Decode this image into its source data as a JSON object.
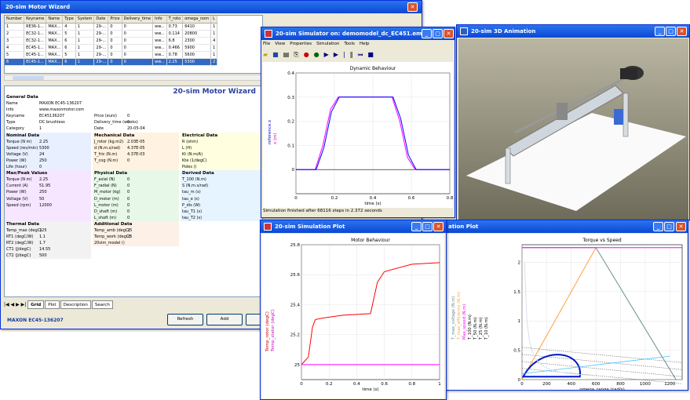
{
  "wizard": {
    "title": "20-sim Motor Wizard",
    "header": "20-sim Motor Wizard",
    "footer": "MAXON EC45-136207",
    "buttons": [
      "Refresh",
      "Add",
      "Cop"
    ],
    "columns": [
      "Number",
      "Keyname",
      "Name",
      "Type",
      "System",
      "Date",
      "Price",
      "Delivery_time",
      "Info",
      "T_roto",
      "omega_nom",
      "L"
    ],
    "rows": [
      [
        "1",
        "RE36-1...",
        "MAX...",
        "4",
        "1",
        "29-...",
        "0",
        "0",
        "ww...",
        "0.73",
        "6410",
        "1"
      ],
      [
        "2",
        "EC32-1...",
        "MAX...",
        "5",
        "1",
        "29-...",
        "0",
        "0",
        "ww...",
        "0.114",
        "20800",
        "1"
      ],
      [
        "3",
        "EC32-1...",
        "MAX...",
        "6",
        "1",
        "29-...",
        "0",
        "0",
        "ww...",
        "6.8",
        "2300",
        "4"
      ],
      [
        "4",
        "EC45-1...",
        "MAX...",
        "6",
        "1",
        "29-...",
        "0",
        "0",
        "ww...",
        "0.466",
        "5900",
        "1"
      ],
      [
        "5",
        "EC45-1...",
        "MAX...",
        "5",
        "1",
        "29-...",
        "0",
        "0",
        "ww...",
        "0.78",
        "5600",
        "1"
      ],
      [
        "6",
        "EC45-1...",
        "MAX...",
        "6",
        "1",
        "29-...",
        "0",
        "0",
        "ww...",
        "2.25",
        "5300",
        "2"
      ]
    ],
    "col1": [
      {
        "t": "General Data",
        "h": true
      },
      {
        "k": "Name",
        "v": "MAXON EC45-136207"
      },
      {
        "k": "Info",
        "v": "www.maxonmotor.com"
      },
      {
        "k": "Keyname",
        "v": "EC45136207"
      },
      {
        "k": "Type",
        "v": "DC brushless"
      },
      {
        "k": "Category",
        "v": "1"
      },
      {
        "t": "Nominal Data",
        "h": true
      },
      {
        "k": "Torque (N m)",
        "v": "2.25"
      },
      {
        "k": "Speed (rev/min)",
        "v": "5300"
      },
      {
        "k": "Voltage (V)",
        "v": "24"
      },
      {
        "k": "Power (W)",
        "v": "250"
      },
      {
        "k": "Life (hour)",
        "v": "0"
      },
      {
        "t": "Max/Peak Values",
        "h": true
      },
      {
        "k": "Torque (N m)",
        "v": "2.25"
      },
      {
        "k": "Current (A)",
        "v": "51.95"
      },
      {
        "k": "Power (W)",
        "v": "250"
      },
      {
        "k": "Voltage (V)",
        "v": "50"
      },
      {
        "k": "Speed (rpm)",
        "v": "12000"
      },
      {
        "k": "",
        "v": ""
      },
      {
        "k": "",
        "v": ""
      },
      {
        "t": "Thermal Data",
        "h": true
      },
      {
        "k": "Temp_max (degC)",
        "v": "125"
      },
      {
        "k": "RT1 (degC/W)",
        "v": "1.1"
      },
      {
        "k": "RT2 (degC/W)",
        "v": "1.7"
      },
      {
        "k": "CT1 (J/degC)",
        "v": "14.55"
      },
      {
        "k": "CT2 (J/degC)",
        "v": "500"
      }
    ],
    "col2": [
      {
        "k": "",
        "v": ""
      },
      {
        "k": "",
        "v": ""
      },
      {
        "k": "",
        "v": ""
      },
      {
        "k": "Price (euro)",
        "v": "0"
      },
      {
        "k": "Delivery_time (weeks)",
        "v": "0"
      },
      {
        "k": "Date",
        "v": "20-05-04"
      },
      {
        "t": "Mechanical Data",
        "h": true
      },
      {
        "k": "J_rotor (kg.m2)",
        "v": "2.03E-05"
      },
      {
        "k": "d (N.m.s/rad)",
        "v": "4.37E-05"
      },
      {
        "k": "T_fric (N.m)",
        "v": "4.37E-03"
      },
      {
        "k": "T_cog (N.m)",
        "v": "0"
      },
      {
        "k": "",
        "v": ""
      },
      {
        "t": "Physical Data",
        "h": true
      },
      {
        "k": "F_axial (N)",
        "v": "0"
      },
      {
        "k": "F_radial (N)",
        "v": "0"
      },
      {
        "k": "M_motor (kg)",
        "v": "0"
      },
      {
        "k": "D_motor (m)",
        "v": "0"
      },
      {
        "k": "L_motor (m)",
        "v": "0"
      },
      {
        "k": "D_shaft (m)",
        "v": "0"
      },
      {
        "k": "L_shaft (m)",
        "v": "0"
      },
      {
        "t": "Additional Data",
        "h": true
      },
      {
        "k": "Temp_amb (degC)",
        "v": "25"
      },
      {
        "k": "Temp_work (degC)",
        "v": "25"
      },
      {
        "k": "20sim_model ()",
        "v": ""
      }
    ],
    "col3": [
      {
        "k": "",
        "v": ""
      },
      {
        "k": "",
        "v": ""
      },
      {
        "k": "",
        "v": ""
      },
      {
        "k": "",
        "v": ""
      },
      {
        "k": "",
        "v": ""
      },
      {
        "k": "",
        "v": ""
      },
      {
        "t": "Electrical Data",
        "h": true
      },
      {
        "k": "R (ohm)",
        "v": ""
      },
      {
        "k": "L (H)",
        "v": ""
      },
      {
        "k": "Kt (N.m/A)",
        "v": ""
      },
      {
        "k": "Kte (1/degC)",
        "v": ""
      },
      {
        "k": "Poles ()",
        "v": ""
      },
      {
        "t": "Derived Data",
        "h": true
      },
      {
        "k": "T_100 (N.m)",
        "v": ""
      },
      {
        "k": "S (N.m.s/rad)",
        "v": ""
      },
      {
        "k": "tau_m (s)",
        "v": ""
      },
      {
        "k": "tau_e (s)",
        "v": ""
      },
      {
        "k": "P_dis (W)",
        "v": ""
      },
      {
        "k": "tau_T1 (s)",
        "v": ""
      },
      {
        "k": "tau_T2 (s)",
        "v": ""
      }
    ],
    "tabs": [
      "Grid",
      "Plot",
      "Description",
      "Search"
    ]
  },
  "sim": {
    "title": "20-sim Simulator on: demomodel_dc_EC451.emx",
    "menu": [
      "File",
      "View",
      "Properties",
      "Simulation",
      "Tools",
      "Help"
    ],
    "plot_title": "Dynamic Behaviour",
    "status": "Simulation finished after 68116 steps in 2.372 seconds",
    "ylabel_a": "reference.x",
    "ylabel_b": "x (m)",
    "xlabel": "time (s)"
  },
  "anim": {
    "title": "20-sim 3D Animation"
  },
  "plot2": {
    "title": "20-sim Simulation Plot",
    "plot_title": "Motor Behaviour",
    "xlabel": "time (s)",
    "ylabel_a": "Temp_rotor (degC)",
    "ylabel_b": "Temp_stator (degC)"
  },
  "plot3": {
    "title": "ation Plot",
    "plot_title": "Torque vs Speed",
    "xlabel": "omega_range (rad/s)",
    "legend": [
      "T_max_voltage (N.m)",
      "T_max_efficiency (N.m)",
      "Max_speed (N.m)",
      "T_100 (N.m)",
      "T_50 (N.m)",
      "T_25 (N.m)",
      "T_10 (N.m)"
    ]
  },
  "chart_data": [
    {
      "type": "line",
      "title": "Dynamic Behaviour",
      "xlabel": "time (s)",
      "ylabel": "reference.x / x (m)",
      "xlim": [
        0,
        0.8
      ],
      "ylim": [
        -0.1,
        0.4
      ],
      "xticks": [
        0,
        0.2,
        0.4,
        0.6,
        0.8
      ],
      "yticks": [
        0,
        0.1,
        0.2,
        0.3,
        0.4
      ],
      "series": [
        {
          "name": "reference.x",
          "color": "#ff00ff",
          "x": [
            0,
            0.1,
            0.14,
            0.18,
            0.22,
            0.5,
            0.54,
            0.58,
            0.62,
            0.8
          ],
          "y": [
            0,
            0,
            0.1,
            0.25,
            0.3,
            0.3,
            0.2,
            0.05,
            0,
            0
          ]
        },
        {
          "name": "x (m)",
          "color": "#0000ff",
          "x": [
            0,
            0.105,
            0.145,
            0.185,
            0.225,
            0.505,
            0.545,
            0.585,
            0.625,
            0.8
          ],
          "y": [
            0,
            0,
            0.09,
            0.24,
            0.3,
            0.3,
            0.21,
            0.06,
            0,
            0
          ]
        }
      ]
    },
    {
      "type": "line",
      "title": "Motor Behaviour",
      "xlabel": "time (s)",
      "ylabel": "Temp_rotor / Temp_stator (degC)",
      "xlim": [
        0,
        1
      ],
      "ylim": [
        24.9,
        25.8
      ],
      "xticks": [
        0,
        0.2,
        0.4,
        0.6,
        0.8,
        1
      ],
      "yticks": [
        25,
        25.2,
        25.4,
        25.6,
        25.8
      ],
      "series": [
        {
          "name": "Temp_rotor (degC)",
          "color": "#ff0000",
          "x": [
            0,
            0.05,
            0.08,
            0.1,
            0.15,
            0.3,
            0.5,
            0.55,
            0.6,
            0.8,
            1
          ],
          "y": [
            25,
            25.05,
            25.25,
            25.3,
            25.31,
            25.33,
            25.34,
            25.55,
            25.62,
            25.67,
            25.68
          ]
        },
        {
          "name": "Temp_stator (degC)",
          "color": "#ff00ff",
          "x": [
            0,
            1
          ],
          "y": [
            25,
            25
          ]
        }
      ]
    },
    {
      "type": "line",
      "title": "Torque vs Speed",
      "xlabel": "omega_range (rad/s)",
      "ylabel": "",
      "xlim": [
        0,
        1300
      ],
      "ylim": [
        0,
        2.3
      ],
      "xticks": [
        0,
        200,
        400,
        600,
        800,
        1000,
        1200
      ],
      "yticks": [
        0,
        0.5,
        1,
        1.5,
        2
      ],
      "series": [
        {
          "name": "T_max_voltage (N.m)",
          "color": "#6b8e8e",
          "x": [
            0,
            600,
            1250
          ],
          "y": [
            2.25,
            2.25,
            0
          ]
        },
        {
          "name": "T_max_efficiency (N.m)",
          "color": "#ffa040",
          "x": [
            0,
            600
          ],
          "y": [
            0,
            2.25
          ]
        },
        {
          "name": "Max_speed (N.m)",
          "color": "#ff00ff",
          "x": [
            0,
            1300
          ],
          "y": [
            2.25,
            2.25
          ]
        }
      ]
    }
  ]
}
